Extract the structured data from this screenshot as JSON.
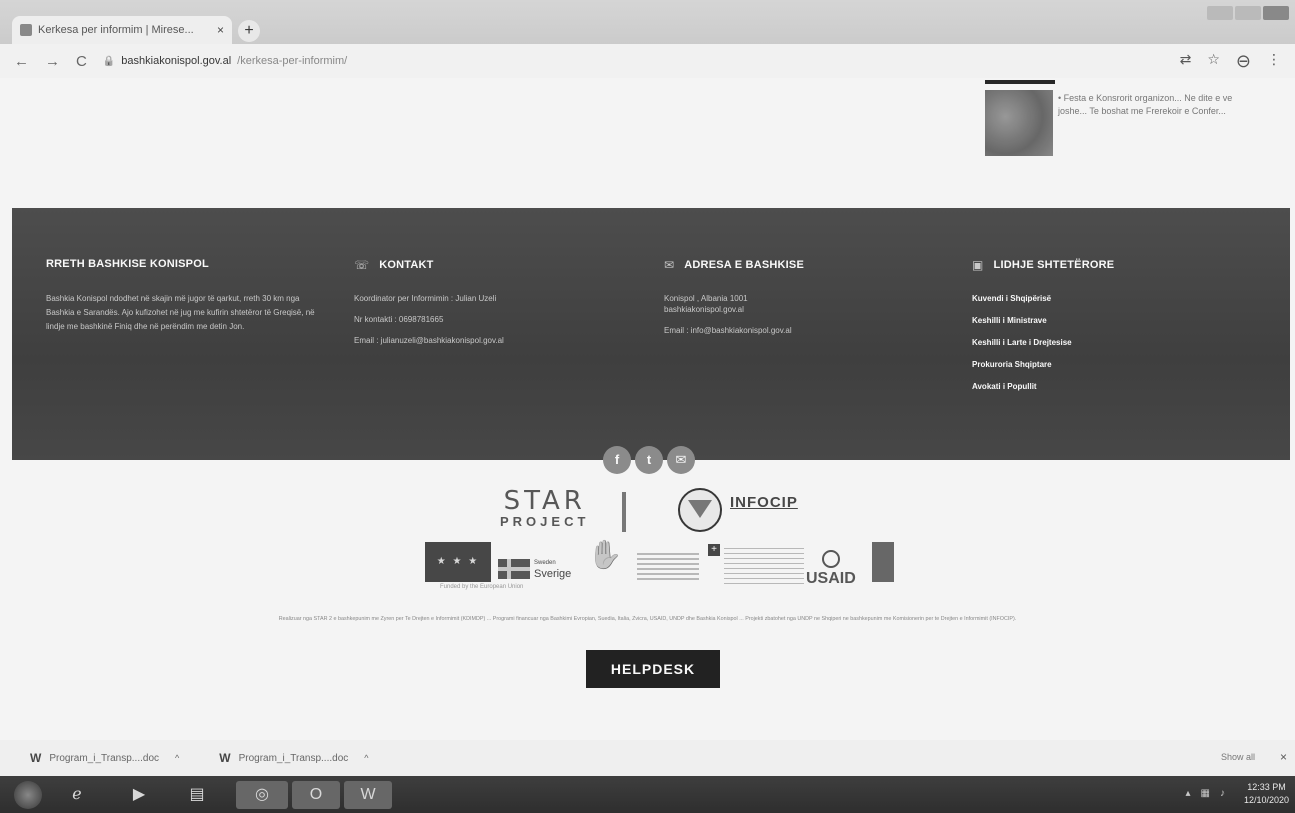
{
  "browser": {
    "tab_title": "Kerkesa per informim | Mirese...",
    "tab_close": "×",
    "new_tab": "+",
    "back": "←",
    "forward": "→",
    "reload": "C",
    "url_host": "bashkiakonispol.gov.al",
    "url_path": "/kerkesa-per-informim/"
  },
  "news": {
    "snippet": "• Festa e Konsrorit organizon... Ne dite e ve joshe... Te boshat me Frerekoir e Confer..."
  },
  "footer": {
    "col1": {
      "title": "RRETH BASHKISE KONISPOL",
      "text": "Bashkia Konispol ndodhet në skajin më jugor të qarkut, rreth 30 km nga Bashkia e Sarandës. Ajo kufizohet në jug me kufirin shtetëror të Greqisë, në lindje me bashkinë Finiq dhe në perëndim me detin Jon."
    },
    "col2": {
      "title": "KONTAKT",
      "icon": "phone-icon",
      "lines": [
        "Koordinator per Informimin : Julian Uzeli",
        "Nr kontakti : 0698781665",
        "Email : julianuzeli@bashkiakonispol.gov.al"
      ]
    },
    "col3": {
      "title": "ADRESA E BASHKISE",
      "icon": "mail-icon",
      "lines": [
        "Konispol , Albania 1001",
        "bashkiakonispol.gov.al",
        "Email : info@bashkiakonispol.gov.al"
      ]
    },
    "col4": {
      "title": "LIDHJE SHTETËRORE",
      "icon": "building-icon",
      "links": [
        "Kuvendi i Shqipërisë",
        "Keshilli i Ministrave",
        "Keshilli i Larte i Drejtesise",
        "Prokuroria Shqiptare",
        "Avokati i Popullit"
      ]
    },
    "social": [
      "f",
      "t",
      "✉"
    ]
  },
  "logos": {
    "star_big": "STAR",
    "star_small": "PROJECT",
    "infocip": "INFOCIP",
    "eu_flag": "★ ★ ★",
    "eu_caption": "Funded by the European Union",
    "sverige": "Sverige",
    "sverige_small": "Sweden",
    "usaid": "USAID"
  },
  "disclaimer": "Realizuar nga STAR 2 e bashkepunim me Zyren per Te Drejten e Informimit (KDIMDP) ... Programi financuar nga Bashkimi Evropian, Suedia, Italia, Zvicra, USAID, UNDP dhe Bashkia Konispol ... Projekti zbatohet nga UNDP ne Shqiperi ne bashkepunim me Komisionerin per te Drejten e Informimit (INFOCIP).",
  "helpdesk": "HELPDESK",
  "downloads": {
    "items": [
      "Program_i_Transp....doc",
      "Program_i_Transp....doc"
    ],
    "show_all": "Show all",
    "close": "×"
  },
  "taskbar": {
    "time": "12:33 PM",
    "date": "12/10/2020"
  }
}
